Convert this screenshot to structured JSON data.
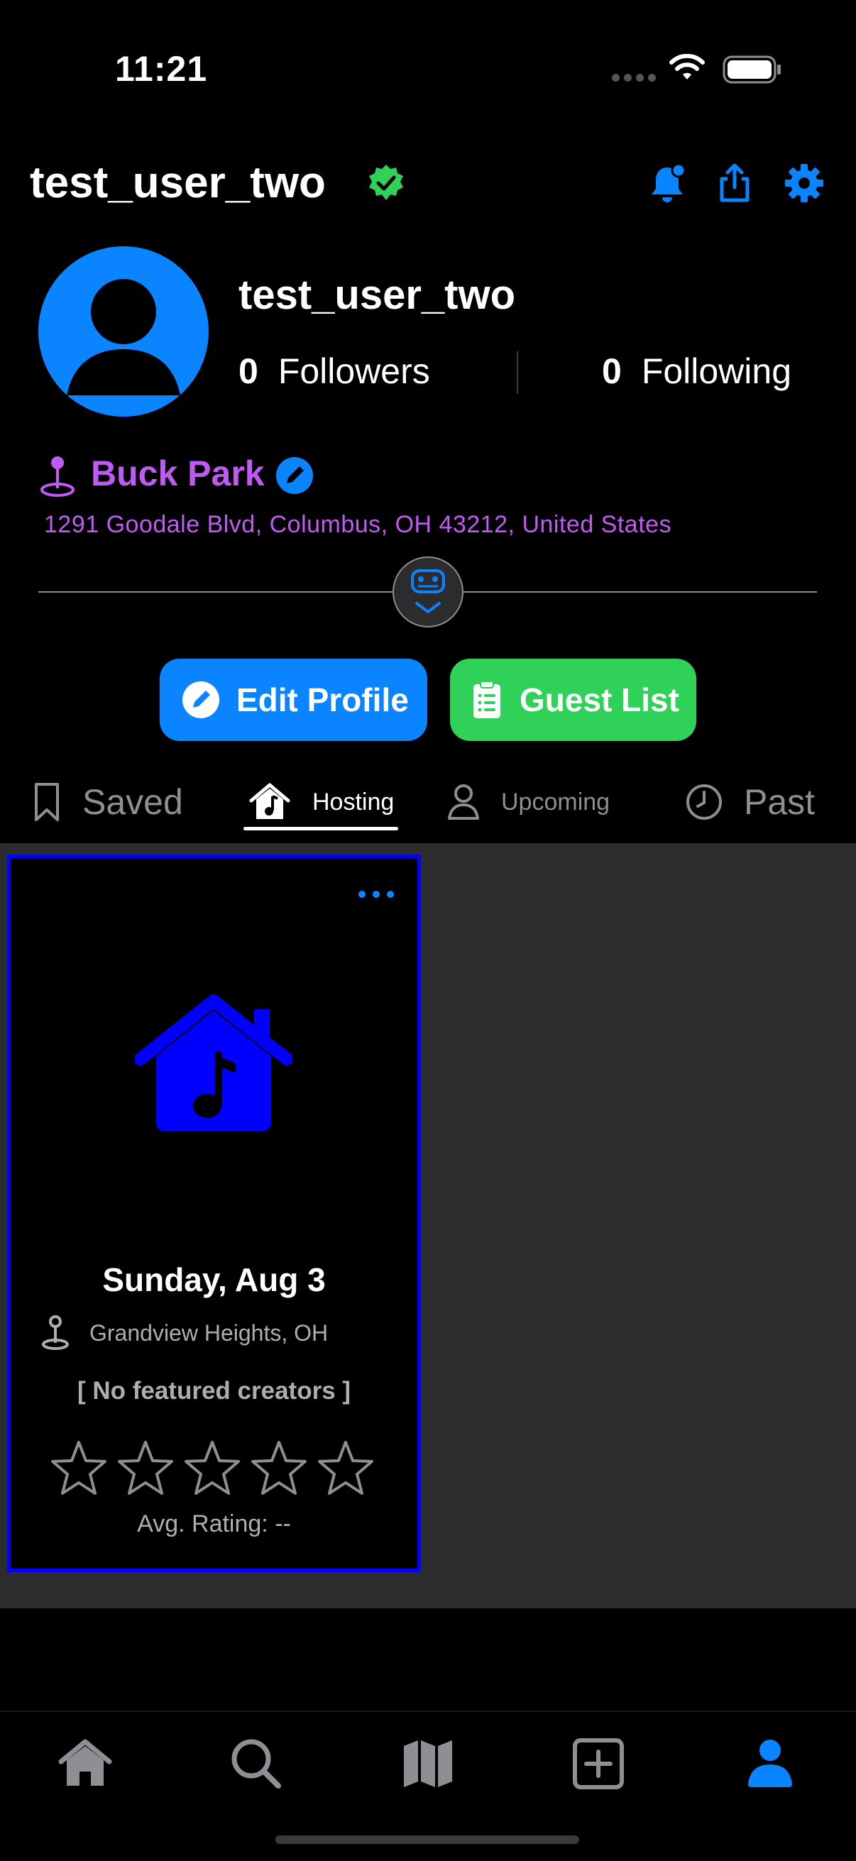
{
  "status_bar": {
    "time": "11:21"
  },
  "header": {
    "username": "test_user_two"
  },
  "profile": {
    "name": "test_user_two",
    "followers_count": "0",
    "followers_label": "Followers",
    "following_count": "0",
    "following_label": "Following"
  },
  "location": {
    "name": "Buck Park",
    "address": "1291 Goodale Blvd, Columbus, OH  43212, United States"
  },
  "buttons": {
    "edit_profile": "Edit Profile",
    "guest_list": "Guest List"
  },
  "tabs": [
    {
      "label": "Saved"
    },
    {
      "label": "Hosting"
    },
    {
      "label": "Upcoming"
    },
    {
      "label": "Past"
    }
  ],
  "active_tab": "Hosting",
  "event_card": {
    "date": "Sunday, Aug 3",
    "location": "Grandview Heights, OH",
    "featured": "[ No featured creators ]",
    "rating_stars": 0,
    "avg_rating": "Avg. Rating: --"
  },
  "tab_bar": [
    {
      "icon": "house-icon"
    },
    {
      "icon": "magnifyingglass-icon"
    },
    {
      "icon": "map-icon"
    },
    {
      "icon": "plus-square-icon"
    },
    {
      "icon": "person-icon"
    }
  ],
  "colors": {
    "accent": "#0a84ff",
    "green": "#30d158",
    "purple": "#bf5af2",
    "card_border": "#0000ff",
    "content_bg": "#2c2c2e"
  }
}
